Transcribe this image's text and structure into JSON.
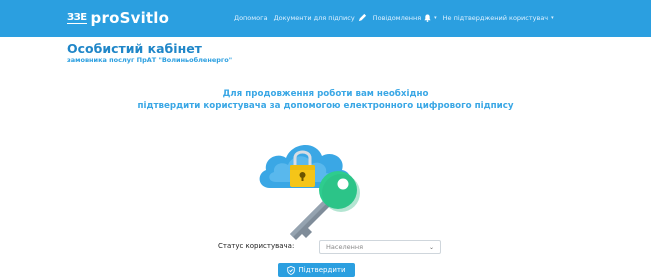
{
  "header": {
    "logo_mark": "ЗЗЕ",
    "logo_text": "proSvitlo",
    "nav": {
      "help": "Допомога",
      "documents": "Документи для підпису",
      "notifications": "Повідомлення",
      "user": "Не підтверджений користувач"
    }
  },
  "cabinet": {
    "title": "Особистий кабінет",
    "subtitle": "замовника послуг ПрАТ \"Волиньобленерго\""
  },
  "notice": {
    "line1": "Для продовження роботи вам необхідно",
    "line2": "підтвердити користувача за допомогою електронного цифрового підпису"
  },
  "form": {
    "status_label": "Статус користувача:",
    "status_value": "Населення",
    "confirm_label": "Підтвердити"
  },
  "colors": {
    "primary": "#2b9fe0",
    "title": "#1f86c8",
    "key_green": "#2ecc8e",
    "cloud_blue": "#4fb3ee",
    "lock_yellow": "#f5c518"
  },
  "icons": [
    "pencil-icon",
    "bell-icon",
    "caret-down-icon",
    "shield-icon",
    "cloud-lock-key-illustration"
  ]
}
